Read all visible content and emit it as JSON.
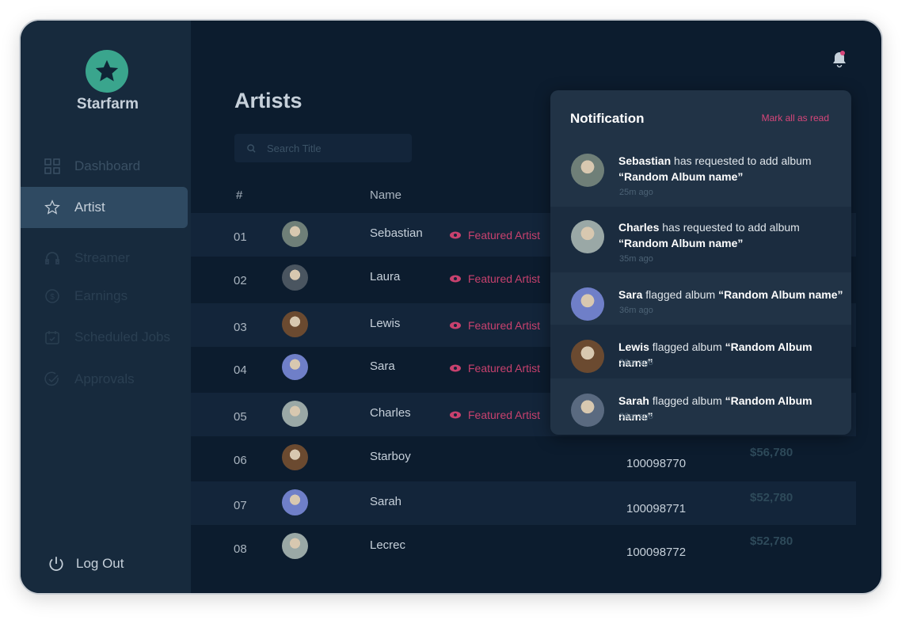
{
  "app": {
    "brand": "Starfarm",
    "logo_icon": "star-icon",
    "accent": "#3aa58d",
    "featured_color": "#c8416e"
  },
  "sidebar": {
    "items": [
      {
        "label": "Dashboard",
        "icon": "grid-icon"
      },
      {
        "label": "Artist",
        "icon": "star-icon",
        "active": true
      },
      {
        "label": "Streamer",
        "icon": "headphones-icon"
      },
      {
        "label": "Earnings",
        "icon": "dollar-circle-icon"
      },
      {
        "label": "Scheduled Jobs",
        "icon": "calendar-icon"
      },
      {
        "label": "Approvals",
        "icon": "check-circle-icon"
      }
    ],
    "logout": "Log Out"
  },
  "main": {
    "title": "Artists",
    "search_placeholder": "Search Title",
    "columns": {
      "num": "#",
      "name": "Name"
    },
    "featured_label": "Featured Artist",
    "rows": [
      {
        "num": "01",
        "name": "Sebastian",
        "featured": true
      },
      {
        "num": "02",
        "name": "Laura",
        "featured": true
      },
      {
        "num": "03",
        "name": "Lewis",
        "featured": true
      },
      {
        "num": "04",
        "name": "Sara",
        "featured": true
      },
      {
        "num": "05",
        "name": "Charles",
        "featured": true
      },
      {
        "num": "06",
        "name": "Starboy",
        "id": "100098770",
        "amount": "$56,780"
      },
      {
        "num": "07",
        "name": "Sarah",
        "id": "100098771",
        "amount": "$52,780"
      },
      {
        "num": "08",
        "name": "Lecrec",
        "id": "100098772",
        "amount": "$52,780"
      }
    ]
  },
  "notifications": {
    "title": "Notification",
    "mark_all": "Mark all as read",
    "items": [
      {
        "user": "Sebastian",
        "action": "has requested to add album",
        "album": "“Random Album name”",
        "time": "25m ago"
      },
      {
        "user": "Charles",
        "action": "has requested to add album",
        "album": "“Random Album name”",
        "time": "35m ago"
      },
      {
        "user": "Sara",
        "action": "flagged album",
        "album": "“Random Album name”",
        "time": "36m ago"
      },
      {
        "user": "Lewis",
        "action": "flagged album",
        "album": "“Random Album name”",
        "time": "36m ago"
      },
      {
        "user": "Sarah",
        "action": "flagged album",
        "album": "“Random Album name”",
        "time": "36m ago"
      }
    ]
  }
}
